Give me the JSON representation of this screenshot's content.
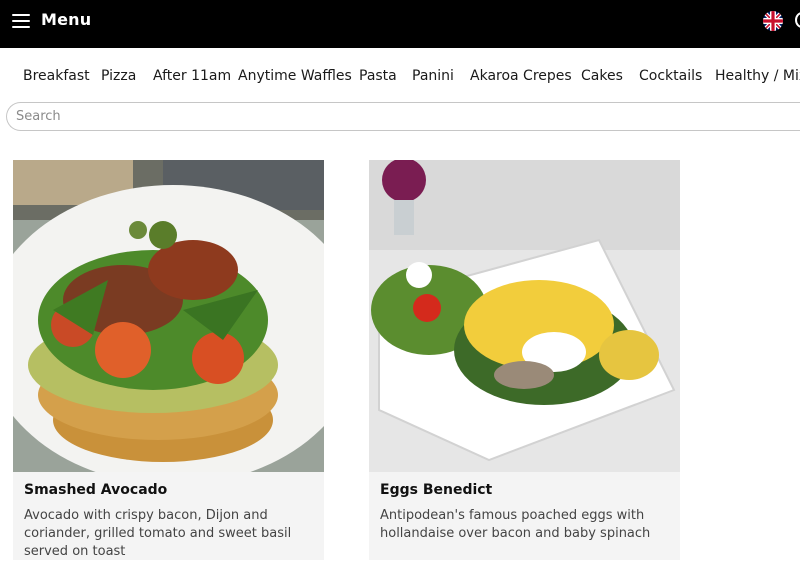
{
  "header": {
    "title": "Menu",
    "hamburger_icon": "hamburger-icon",
    "language_icon": "uk-flag-icon"
  },
  "categories": [
    "Breakfast",
    "Pizza",
    "After 11am",
    "Anytime Waffles",
    "Pasta",
    "Panini",
    "Akaroa Crepes",
    "Cakes",
    "Cocktails",
    "Healthy / Mix"
  ],
  "search": {
    "placeholder": "Search"
  },
  "items": [
    {
      "name": "Smashed Avocado",
      "description": "Avocado with crispy bacon, Dijon and coriander, grilled tomato and sweet basil served on toast"
    },
    {
      "name": "Eggs Benedict",
      "description": "Antipodean's famous poached eggs with hollandaise over bacon and baby spinach"
    }
  ],
  "colors": {
    "header_bg": "#000000",
    "card_bg": "#f4f4f4"
  }
}
